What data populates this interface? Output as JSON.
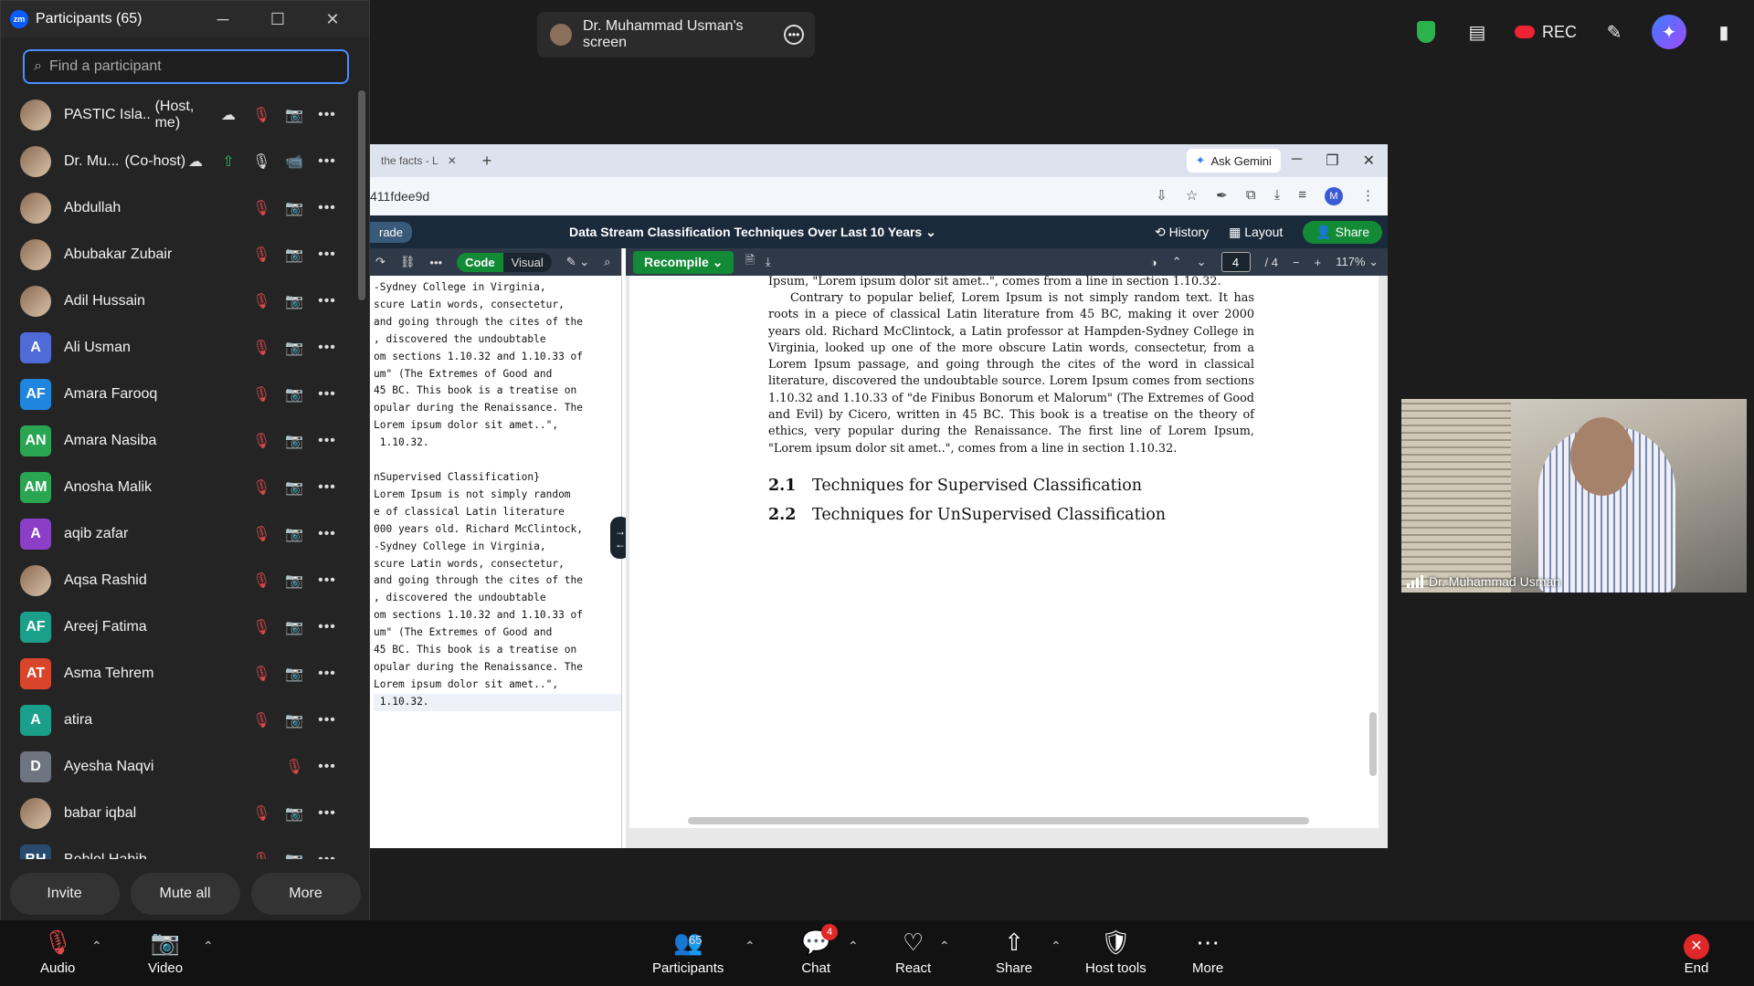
{
  "share_pill": {
    "label": "Dr. Muhammad Usman's screen"
  },
  "top_bar": {
    "rec_label": "REC"
  },
  "panel": {
    "title": "Participants (65)",
    "search_placeholder": "Find a participant",
    "participants": [
      {
        "name": "PASTIC Isla...",
        "tag": "(Host, me)",
        "avatar": "photo"
      },
      {
        "name": "Dr. Mu...",
        "tag": "(Co-host)",
        "avatar": "photo"
      },
      {
        "name": "Abdullah",
        "tag": "",
        "avatar": "photo"
      },
      {
        "name": "Abubakar Zubair",
        "tag": "",
        "avatar": "photo"
      },
      {
        "name": "Adil Hussain",
        "tag": "",
        "avatar": "photo"
      },
      {
        "name": "Ali Usman",
        "tag": "",
        "avatar": "A",
        "color": "#4f6bd8"
      },
      {
        "name": "Amara Farooq",
        "tag": "",
        "avatar": "AF",
        "color": "#1f86e0"
      },
      {
        "name": "Amara Nasiba",
        "tag": "",
        "avatar": "AN",
        "color": "#2aa653"
      },
      {
        "name": "Anosha Malik",
        "tag": "",
        "avatar": "AM",
        "color": "#2aa653"
      },
      {
        "name": "aqib zafar",
        "tag": "",
        "avatar": "A",
        "color": "#8b3fc8"
      },
      {
        "name": "Aqsa Rashid",
        "tag": "",
        "avatar": "photo"
      },
      {
        "name": "Areej Fatima",
        "tag": "",
        "avatar": "AF",
        "color": "#1aa08a"
      },
      {
        "name": "Asma Tehrem",
        "tag": "",
        "avatar": "AT",
        "color": "#d9452b"
      },
      {
        "name": "atira",
        "tag": "",
        "avatar": "A",
        "color": "#1aa08a"
      },
      {
        "name": "Ayesha Naqvi",
        "tag": "",
        "avatar": "D",
        "color": "#6e7480"
      },
      {
        "name": "babar iqbal",
        "tag": "",
        "avatar": "photo"
      },
      {
        "name": "Behlol Habib",
        "tag": "",
        "avatar": "BH",
        "color": "#274a6e"
      }
    ],
    "buttons": {
      "invite": "Invite",
      "mute_all": "Mute all",
      "more": "More"
    }
  },
  "browser": {
    "tab_label": "the facts - L",
    "gemini_label": "Ask Gemini",
    "url": "411fdee9d",
    "profile_initial": "M",
    "overleaf": {
      "upgrade_label": "rade",
      "doc_title": "Data Stream Classification Techniques Over Last 10 Years",
      "history_label": "History",
      "layout_label": "Layout",
      "share_label": "Share",
      "code_label": "Code",
      "visual_label": "Visual",
      "recompile_label": "Recompile",
      "page_current": "4",
      "page_total": "/ 4",
      "zoom": "117%"
    },
    "code_lines": [
      "-Sydney College in Virginia,",
      "scure Latin words, consectetur,",
      "and going through the cites of the",
      ", discovered the undoubtable",
      "om sections 1.10.32 and 1.10.33 of",
      "um\" (The Extremes of Good and",
      "45 BC. This book is a treatise on",
      "opular during the Renaissance. The",
      "Lorem ipsum dolor sit amet..\",",
      " 1.10.32.",
      "",
      "nSupervised Classification}",
      "Lorem Ipsum is not simply random",
      "e of classical Latin literature",
      "000 years old. Richard McClintock,",
      "-Sydney College in Virginia,",
      "scure Latin words, consectetur,",
      "and going through the cites of the",
      ", discovered the undoubtable",
      "om sections 1.10.32 and 1.10.33 of",
      "um\" (The Extremes of Good and",
      "45 BC. This book is a treatise on",
      "opular during the Renaissance. The",
      "Lorem ipsum dolor sit amet..\",",
      " 1.10.32."
    ],
    "pdf": {
      "para_top": "Ipsum, \"Lorem ipsum dolor sit amet..\", comes from a line in section 1.10.32.",
      "para_main": "Contrary to popular belief, Lorem Ipsum is not simply random text. It has roots in a piece of classical Latin literature from 45 BC, making it over 2000 years old. Richard McClintock, a Latin professor at Hampden-Sydney College in Virginia, looked up one of the more obscure Latin words, consectetur, from a Lorem Ipsum passage, and going through the cites of the word in classical literature, discovered the undoubtable source. Lorem Ipsum comes from sections 1.10.32 and 1.10.33 of \"de Finibus Bonorum et Malorum\" (The Extremes of Good and Evil) by Cicero, written in 45 BC. This book is a treatise on the theory of ethics, very popular during the Renaissance. The first line of Lorem Ipsum, \"Lorem ipsum dolor sit amet..\", comes from a line in section 1.10.32.",
      "sec1_num": "2.1",
      "sec1_title": "Techniques for Supervised Classification",
      "sec2_num": "2.2",
      "sec2_title": "Techniques for UnSupervised Classification"
    }
  },
  "video": {
    "name": "Dr. Muhammad Usman"
  },
  "toolbar": {
    "audio": "Audio",
    "video": "Video",
    "participants": "Participants",
    "participants_count": "65",
    "chat": "Chat",
    "chat_badge": "4",
    "react": "React",
    "share": "Share",
    "host_tools": "Host tools",
    "more": "More",
    "end": "End"
  },
  "colors": {
    "accent": "#0b5cff",
    "overleaf_green": "#138a36",
    "muted_red": "#e04a4a",
    "end_red": "#e02828"
  }
}
